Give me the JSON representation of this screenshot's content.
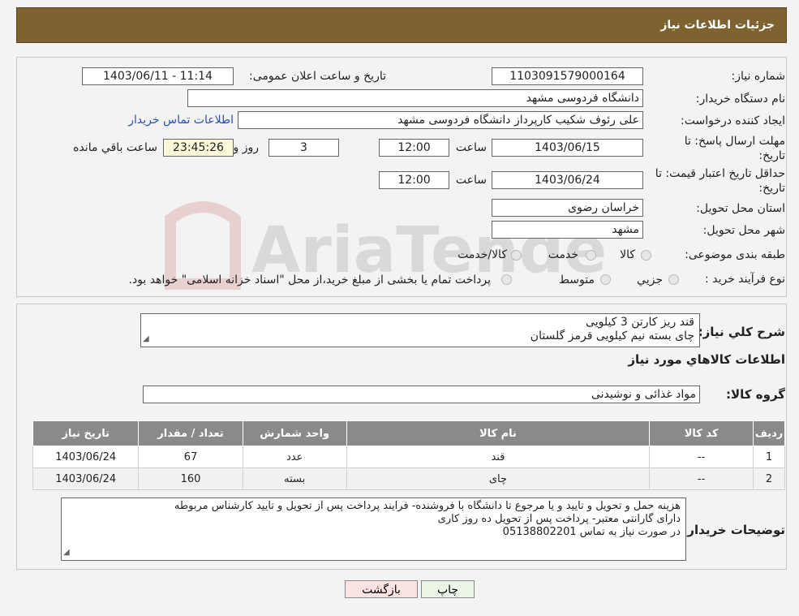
{
  "header": {
    "title": "جزئیات اطلاعات نیاز"
  },
  "info": {
    "need_number_label": "شماره نیاز:",
    "need_number": "1103091579000164",
    "announce_label": "تاریخ و ساعت اعلان عمومی:",
    "announce_value": "1403/06/11 - 11:14",
    "buyer_org_label": "نام دستگاه خریدار:",
    "buyer_org": "دانشگاه فردوسی مشهد",
    "creator_label": "ایجاد کننده درخواست:",
    "creator": "علی رئوف شکیب کارپرداز دانشگاه فردوسی مشهد",
    "contact_link": "اطلاعات تماس خریدار",
    "deadline_label_1": "مهلت ارسال پاسخ: تا",
    "deadline_label_2": "تاریخ:",
    "deadline_date": "1403/06/15",
    "time_word": "ساعت",
    "deadline_time": "12:00",
    "days": "3",
    "days_word": "روز و",
    "remaining_time": "23:45:26",
    "remaining_word": "ساعت باقي مانده",
    "price_validity_label_1": "حداقل تاریخ اعتبار قیمت: تا",
    "price_validity_label_2": "تاریخ:",
    "price_validity_date": "1403/06/24",
    "price_validity_time": "12:00",
    "province_label": "استان محل تحویل:",
    "province": "خراسان رضوی",
    "city_label": "شهر محل تحویل:",
    "city": "مشهد",
    "category_label": "طبقه بندی موضوعی:",
    "category_options": [
      "کالا",
      "خدمت",
      "کالا/خدمت"
    ],
    "process_label": "نوع فرآیند خرید :",
    "process_options": [
      "جزيي",
      "متوسط"
    ],
    "process_note": "پرداخت تمام یا بخشی از مبلغ خرید،از محل \"اسناد خزانه اسلامی\" خواهد بود."
  },
  "summary": {
    "label": "شرح کلي نياز:",
    "lines": [
      "قند ریز کارتن 3 کیلویی",
      "چای بسته نیم کیلویی قرمز گلستان"
    ],
    "goods_info_title": "اطلاعات کالاهاي مورد نياز",
    "group_label": "گروه کالا:",
    "group_value": "مواد غذائی و نوشیدنی"
  },
  "table": {
    "headers": [
      "رديف",
      "کد کالا",
      "نام کالا",
      "واحد شمارش",
      "تعداد / مقدار",
      "تاریخ نیاز"
    ],
    "rows": [
      [
        "1",
        "--",
        "قند",
        "عدد",
        "67",
        "1403/06/24"
      ],
      [
        "2",
        "--",
        "چای",
        "بسته",
        "160",
        "1403/06/24"
      ]
    ]
  },
  "notes": {
    "label": "توضیحات خریدار:",
    "lines": [
      "هزینه حمل و تحویل و تایید و یا مرجوع تا دانشگاه با فروشنده- فرایند پرداخت پس از تحویل و تایید کارشناس مربوطه",
      "دارای گارانتی معتبر- پرداخت پس از تحویل ده روز کاری",
      "در صورت نیاز به تماس 05138802201"
    ]
  },
  "buttons": {
    "print": "چاپ",
    "back": "بازگشت"
  },
  "watermark": {
    "text": "AriaTender.neT"
  },
  "colors": {
    "header": "#7e6230",
    "back_button": "#fbe3e3",
    "print_button": "#eaf7e6",
    "table_header": "#8a8a8a"
  }
}
